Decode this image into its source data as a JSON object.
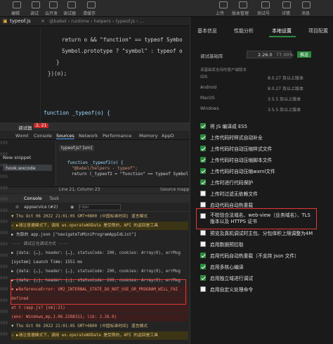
{
  "toolbar": {
    "labels": [
      "编辑",
      "调试",
      "云开发",
      "调试器",
      "清缓存"
    ],
    "right": [
      "上传",
      "版本管理",
      "测试号",
      "详情",
      "消息"
    ]
  },
  "editor": {
    "tab": "typeof.js",
    "breadcrumb": "@babel › runtime › helpers › typeof.js › ...",
    "lines": [
      "return o && \"function\" == typeof Symbo",
      "Symbol.prototype ? \"symbol\" : typeof o",
      "}",
      "})(o);",
      "",
      "",
      "function _typeof(o) {"
    ]
  },
  "devtools": {
    "title": "调试器",
    "badge": "2, 21",
    "tabs": [
      "Wxml",
      "Console",
      "Sources",
      "Network",
      "Performance",
      "Memory",
      "AppD"
    ],
    "sources": {
      "new_snippet": "New snippet",
      "file": "hook.wxcode",
      "open_tab": "typeof.js? [sm]",
      "code": [
        "function _typeof2(o) {",
        "\"@babel/helpers - typeof\";",
        "return (_typeof2 = \"function\" == typeof Symbol &"
      ],
      "status": "Line 21, Column 23",
      "status_right": "(source mapp"
    },
    "console_tabs": [
      "Console",
      "Task"
    ],
    "context": "appservice (#2)",
    "filter_placeholder": "Filter",
    "lines": [
      {
        "text": "▼ Thu Oct 06 2022 21:01:05 GMT+0800 (中国标准时间) 道言模式",
        "color": "#d7ba7d"
      },
      {
        "text": "⚠ ▶请注意遵模式下，调用 wx.operateWXData 是受限的，API 的返回是工具",
        "color": "#e6c07b",
        "bg": "#3b3515"
      },
      {
        "text": "▶ 先取的 app.json [\"navigateToMiniProgramAppIdList\"]",
        "color": "#ccc"
      },
      {
        "text": "---- 调试正在调试方式 ----",
        "color": "#999"
      },
      {
        "text": "▶ {data: {…}, header: {…}, statusCode: 200, cookies: Array(0), errMsg",
        "color": "#bbb"
      },
      {
        "text": "[system] Launch Time: 1551 ms",
        "color": "#ccc"
      },
      {
        "text": "▶ {data: {…}, header: {…}, statusCode: 200, cookies: Array(0), errMsg",
        "color": "#bbb"
      },
      {
        "text": "▶ {data: {…}, header: {…}, statusCode: 200, cookies: Array(0), errMsg",
        "color": "#bbb"
      },
      {
        "text": "✖ ▶ReferenceError: VM2_INTERNAL_STATE_DO_NOT_USE_OR_PROGRAM_WILL_FAI",
        "color": "#f48771",
        "bg": "#3b1d1d"
      },
      {
        "text": "   defined",
        "color": "#f48771",
        "bg": "#3b1d1d"
      },
      {
        "text": "     at t (app.js? [sm]:21)",
        "color": "#f48771",
        "bg": "#3b1d1d"
      },
      {
        "text": "   (env: Windows,mp,1.06.2208311; lib: 2.26.0)",
        "color": "#f48771",
        "bg": "#3b1d1d"
      },
      {
        "text": "▼ Thu Oct 06 2022 21:01:05 GMT+0800 (中国标准时间) 道言模式",
        "color": "#d7ba7d"
      },
      {
        "text": "⚠ ▶请注意遵模式下，调用 wx.operateWXData 是受限的，API 的返回是工具",
        "color": "#e6c07b",
        "bg": "#3b3515"
      }
    ],
    "gutter": [
      "999",
      "999",
      "999",
      "999",
      "999",
      "999",
      "999",
      "999",
      "999",
      "999",
      "999",
      "999",
      "999",
      "999",
      "999",
      "999",
      "999",
      "999"
    ]
  },
  "panel": {
    "tabs": [
      "基本信息",
      "性能分析",
      "本地设置",
      "项目配置"
    ],
    "lib_label": "调试基础库",
    "lib_version": "2.26.0",
    "lib_percent": "77.00%",
    "lib_tag": "推送",
    "support_title": "该基础库支持的客户端版本",
    "platforms": [
      {
        "name": "iOS",
        "ver": "8.0.27 及以上版本"
      },
      {
        "name": "Android",
        "ver": "8.0.27 及以上版本"
      },
      {
        "name": "MacOS",
        "ver": "3.5.5 及以上版本"
      },
      {
        "name": "Windows",
        "ver": "3.5.5 及以上版本"
      }
    ],
    "options": [
      {
        "label": "将 JS 编译成 ES5",
        "on": true
      },
      {
        "label": "上传代码时样式自动补全",
        "on": true
      },
      {
        "label": "上传代码时自动压缩样式文件",
        "on": true
      },
      {
        "label": "上传代码时自动压缩脚本文件",
        "on": true
      },
      {
        "label": "上传代码时自动压缩wxml文件",
        "on": true
      },
      {
        "label": "上传时进行代码保护",
        "on": true
      },
      {
        "label": "上传时过滤无依赖文件",
        "on": false
      },
      {
        "label": "启动代码自动热重载",
        "on": false
      },
      {
        "label": "不校验合法域名、web-view（业务域名）、TLS 版本以及 HTTPS 证书",
        "on": false
      },
      {
        "label": "预览及真机调试时主包、分包体积上限调整为4M",
        "on": false
      },
      {
        "label": "启用数据预拉取",
        "on": false
      },
      {
        "label": "启用代码自动热重载（不支持 json 文件）",
        "on": true
      },
      {
        "label": "启用多核心编译",
        "on": true
      },
      {
        "label": "启用独立域进行调试",
        "on": true
      },
      {
        "label": "启用自定义处理命令",
        "on": false
      }
    ]
  },
  "colors": {
    "accent": "#2b8a3e",
    "highlight": "#e53935",
    "error": "#f48771",
    "warning": "#e6c07b"
  }
}
